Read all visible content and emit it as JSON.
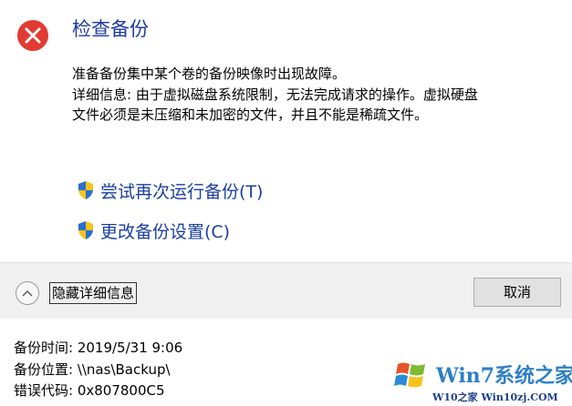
{
  "dialog": {
    "title": "检查备份",
    "message_lines": [
      "准备备份集中某个卷的备份映像时出现故障。",
      "详细信息: 由于虚拟磁盘系统限制，无法完成请求的操作。虚拟硬盘",
      "文件必须是未压缩和未加密的文件，并且不能是稀疏文件。"
    ],
    "error_icon": "error-x-icon"
  },
  "commands": [
    {
      "label": "尝试再次运行备份(T)",
      "icon": "uac-shield-icon"
    },
    {
      "label": "更改备份设置(C)",
      "icon": "uac-shield-icon"
    }
  ],
  "footer": {
    "toggle_label": "隐藏详细信息",
    "toggle_icon": "chevron-up-icon",
    "cancel_label": "取消"
  },
  "details": {
    "time": "备份时间: 2019/5/31 9:06",
    "location": "备份位置: \\\\nas\\Backup\\",
    "error_code": "错误代码: 0x807800C5"
  },
  "watermark": {
    "title": "Win7系统之家",
    "url": "W10之家 Win10zj.COM"
  },
  "colors": {
    "title": "#1f3b9c",
    "command_link": "#1a3f9f",
    "error_red": "#e23b32",
    "footer_bg": "#f0f0f0"
  }
}
